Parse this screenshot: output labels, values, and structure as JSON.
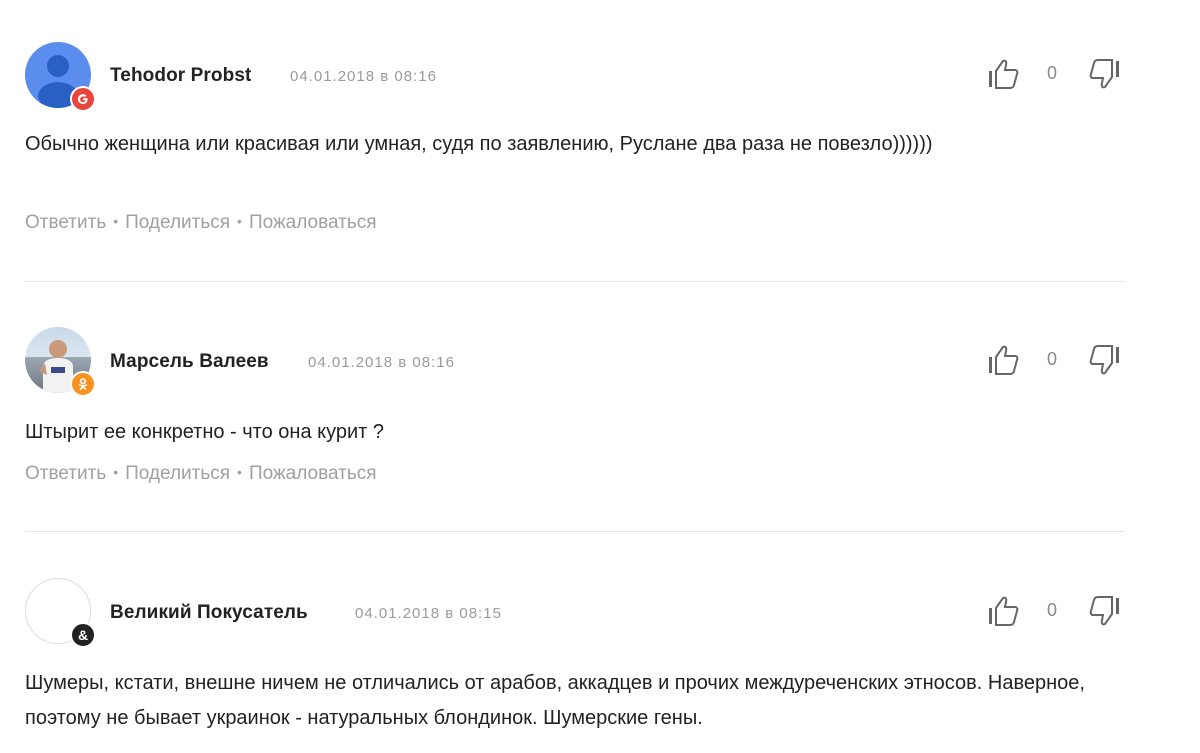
{
  "comments": [
    {
      "author": "Tehodor Probst",
      "date": "04.01.2018 в 08:16",
      "text": "Обычно женщина или красивая или умная, судя по заявлению, Руслане два раза не повезло))))))",
      "badge": "G",
      "badge_color": "#e8453c",
      "likes": "0",
      "actions": {
        "reply": "Ответить",
        "share": "Поделиться",
        "report": "Пожаловаться"
      }
    },
    {
      "author": "Марсель Валеев",
      "date": "04.01.2018 в 08:16",
      "text": "Штырит ее конкретно - что она курит ?",
      "badge": "ok",
      "badge_color": "#f7931e",
      "likes": "0",
      "actions": {
        "reply": "Ответить",
        "share": "Поделиться",
        "report": "Пожаловаться"
      }
    },
    {
      "author": "Великий Покусатель",
      "date": "04.01.2018 в 08:15",
      "text": "Шумеры, кстати, внешне ничем не отличались от арабов, аккадцев и прочих междуреченских этносов. Наверное, поэтому не бывает украинок - натуральных блондинок. Шумерские гены.",
      "badge": "&",
      "badge_color": "#222222",
      "likes": "0"
    }
  ]
}
